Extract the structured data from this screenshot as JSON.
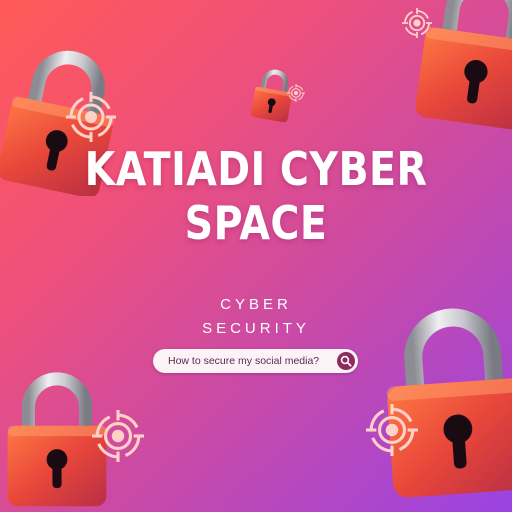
{
  "title_lines": [
    "KATIADI CYBER",
    "SPACE"
  ],
  "subtitle_lines": [
    "CYBER",
    "SECURITY"
  ],
  "search": {
    "text": "How to secure my social media?",
    "icon": "magnifier"
  },
  "colors": {
    "gradient_start": "#ff5a57",
    "gradient_end": "#9a44e2",
    "lock_body": "#e8463a",
    "lock_shackle": "#c8c8cc",
    "target": "#ffd1c7",
    "search_button": "#8e2a5e"
  },
  "decorations": [
    "padlock-icon",
    "crosshair-target-icon"
  ]
}
